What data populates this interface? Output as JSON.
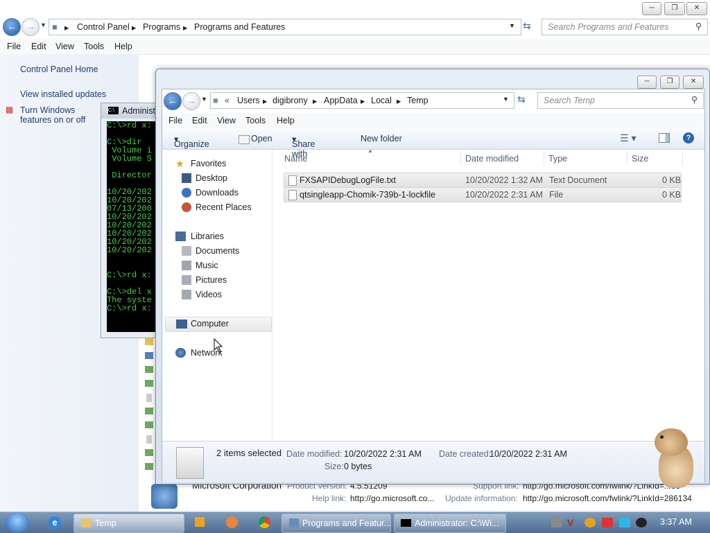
{
  "bg_window": {
    "breadcrumb": [
      "Control Panel",
      "Programs",
      "Programs and Features"
    ],
    "search_placeholder": "Search Programs and Features",
    "menu": [
      "File",
      "Edit",
      "View",
      "Tools",
      "Help"
    ],
    "links": [
      "Control Panel Home",
      "View installed updates",
      "Turn Windows features on or off"
    ],
    "cmd_title": "Administ",
    "cmd_lines": [
      "C:\\>rd x:",
      "",
      "C:\\>dir",
      " Volume i",
      " Volume S",
      "",
      " Director",
      "",
      "10/20/202",
      "10/20/202",
      "07/13/200",
      "10/20/202",
      "10/20/202",
      "10/20/202",
      "10/20/202",
      "10/20/202",
      "",
      "",
      "C:\\>rd x:",
      "",
      "C:\\>del x",
      "The syste",
      "C:\\>rd x:"
    ],
    "product": {
      "publisher": "Microsoft Corporation",
      "version_label": "Product version:",
      "version": "4.5.51209",
      "support_label": "Support link:",
      "support": "http://go.microsoft.com/fwlink/?LinkId=...63",
      "help_label": "Help link:",
      "help": "http://go.microsoft.co...",
      "update_label": "Update information:",
      "update": "http://go.microsoft.com/fwlink/?LinkId=286134"
    }
  },
  "explorer": {
    "breadcrumb": [
      "Users",
      "digibrony",
      "AppData",
      "Local",
      "Temp"
    ],
    "search_placeholder": "Search Temp",
    "menu": [
      "File",
      "Edit",
      "View",
      "Tools",
      "Help"
    ],
    "toolbar": {
      "organize": "Organize",
      "open": "Open",
      "share": "Share with",
      "new_folder": "New folder"
    },
    "nav": {
      "favorites": "Favorites",
      "fav_items": [
        "Desktop",
        "Downloads",
        "Recent Places"
      ],
      "libraries": "Libraries",
      "lib_items": [
        "Documents",
        "Music",
        "Pictures",
        "Videos"
      ],
      "computer": "Computer",
      "network": "Network"
    },
    "columns": [
      "Name",
      "Date modified",
      "Type",
      "Size"
    ],
    "files": [
      {
        "name": "FXSAPIDebugLogFile.txt",
        "date": "10/20/2022 1:32 AM",
        "type": "Text Document",
        "size": "0 KB"
      },
      {
        "name": "qtsingleapp-Chomik-739b-1-lockfile",
        "date": "10/20/2022 2:31 AM",
        "type": "File",
        "size": "0 KB"
      }
    ],
    "details": {
      "selected": "2 items selected",
      "modified_label": "Date modified:",
      "modified": "10/20/2022 2:31 AM",
      "created_label": "Date created:",
      "created": "10/20/2022 2:31 AM",
      "size_label": "Size:",
      "size": "0 bytes"
    }
  },
  "taskbar": {
    "buttons": [
      "Temp",
      "Programs and Featur...",
      "Administrator: C:\\Wi..."
    ],
    "clock": "3:37 AM"
  },
  "colors": {
    "accent": "#1e5aa8",
    "taskbar": "#5a7799",
    "cmd_text": "#3fd34a"
  }
}
